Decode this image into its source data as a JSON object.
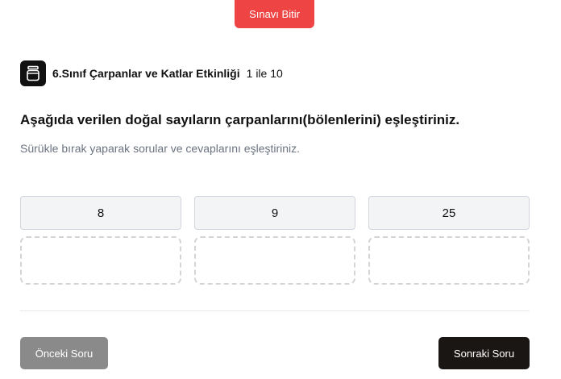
{
  "header": {
    "finish_label": "Sınavı Bitir"
  },
  "activity": {
    "icon": "jar-icon",
    "title": "6.Sınıf Çarpanlar ve Katlar Etkinliği",
    "range": "1 ile 10"
  },
  "question": {
    "prompt": "Aşağıda verilen doğal sayıların çarpanlarını(bölenlerini) eşleştiriniz.",
    "instruction": "Sürükle bırak yaparak sorular ve cevaplarını eşleştiriniz."
  },
  "answers": [
    "8",
    "9",
    "25"
  ],
  "footer": {
    "prev_label": "Önceki Soru",
    "next_label": "Sonraki Soru"
  },
  "colors": {
    "finish_button": "#ef4444",
    "prev_button": "#8a8a8a",
    "next_button": "#1a1614"
  }
}
